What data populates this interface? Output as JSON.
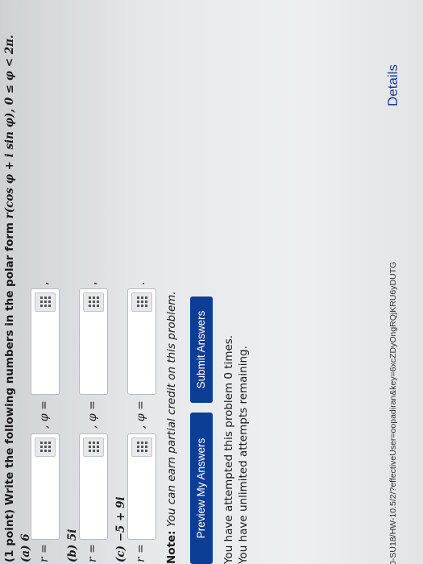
{
  "problem": {
    "points": "(1 point)",
    "prompt": "Write the following numbers in the polar form",
    "form": "r(cos φ + i sin φ), 0 ≤ φ < 2π."
  },
  "parts": [
    {
      "label": "(a) 6",
      "r_label": "r =",
      "phi_label": ", φ =",
      "r_value": "",
      "phi_value": "",
      "end": ","
    },
    {
      "label": "(b) 5i",
      "r_label": "r =",
      "phi_label": ", φ =",
      "r_value": "",
      "phi_value": "",
      "end": ","
    },
    {
      "label": "(c) −5 + 9i",
      "r_label": "r =",
      "phi_label": ", φ =",
      "r_value": "",
      "phi_value": "",
      "end": "."
    }
  ],
  "note": {
    "lead": "Note:",
    "text": "You can earn partial credit on this problem."
  },
  "buttons": {
    "preview": "Preview My Answers",
    "submit": "Submit Answers"
  },
  "status": {
    "attempts": "You have attempted this problem 0 times.",
    "unlimited": "You have unlimited attempts remaining."
  },
  "footer": {
    "url": "112-90-SU18/HW-10.5/2/?effectiveUser=oopadiran&key=6xcZDyOngRQjKRU6yDUTG",
    "details": "Details"
  },
  "colors": {
    "button_bg": "#0e3d96",
    "button_text": "#ffffff",
    "input_bg": "#ffffff"
  },
  "icons": {
    "keyboard": "equation-editor-icon"
  }
}
